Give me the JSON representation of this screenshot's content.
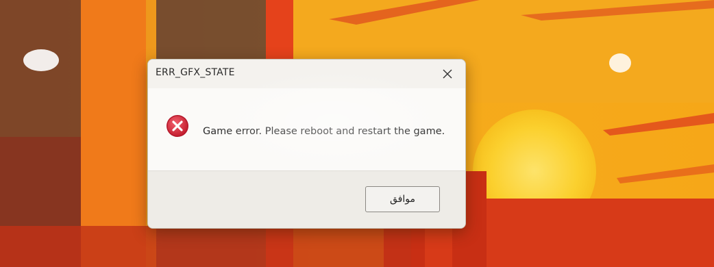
{
  "dialog": {
    "title": "ERR_GFX_STATE",
    "message": "Game error. Please reboot and restart the game.",
    "ok_label": "موافق",
    "close_symbol": "✕",
    "icon": "error-icon"
  },
  "colors": {
    "background_orange": "#f2a11c",
    "background_red": "#d9441c",
    "sun_yellow": "#fbd63a",
    "error_red": "#d6283a"
  }
}
